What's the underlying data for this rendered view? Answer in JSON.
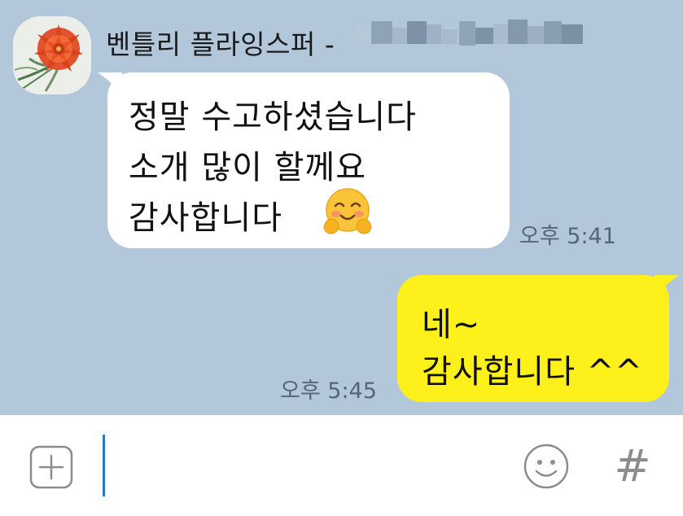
{
  "colors": {
    "chat_background": "#b2c7da",
    "incoming_bubble": "#ffffff",
    "outgoing_bubble": "#fef01b",
    "timestamp_text": "#556677",
    "cursor": "#2979c1",
    "icon_gray": "#8c8c8c"
  },
  "conversation": {
    "sender": {
      "name": "벤틀리 플라잉스퍼 -",
      "name_suffix_blurred": true,
      "avatar_icon": "red-flower-photo"
    },
    "messages": [
      {
        "direction": "incoming",
        "lines": [
          "정말 수고하셨습니다",
          "소개 많이 할께요",
          "감사합니다"
        ],
        "emoji": "smiling-face-with-open-hands",
        "time": "오후 5:41"
      },
      {
        "direction": "outgoing",
        "lines": [
          "네~",
          "감사합니다 ^^"
        ],
        "time": "오후 5:45"
      }
    ]
  },
  "input_bar": {
    "attach_icon": "plus-square-icon",
    "message_value": "",
    "emoticon_icon": "smiley-icon",
    "hashtag_label": "#"
  }
}
